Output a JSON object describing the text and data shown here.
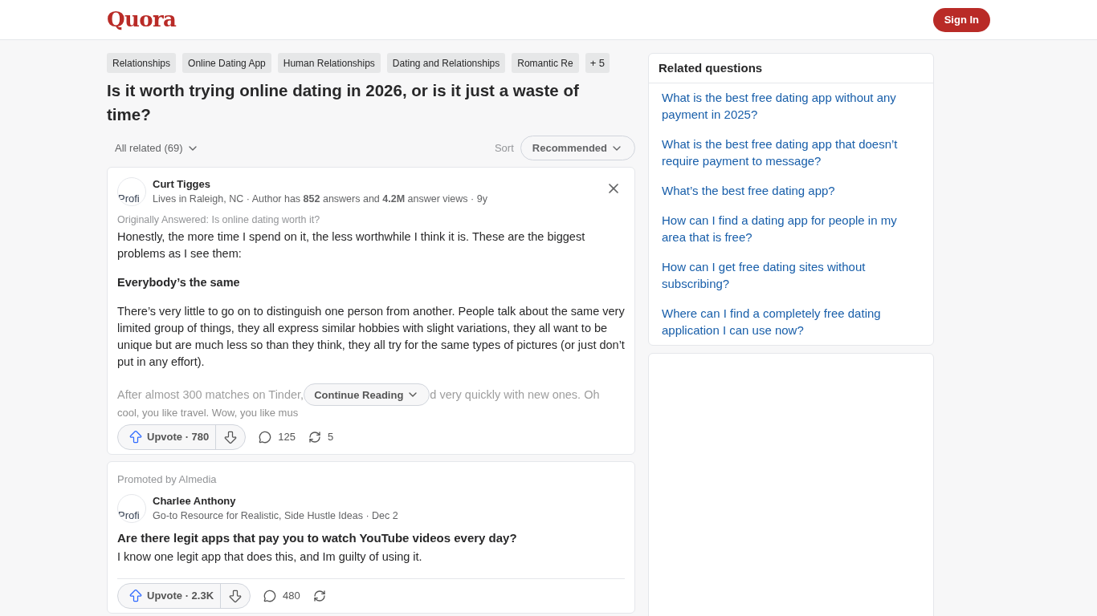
{
  "header": {
    "logo": "Quora",
    "sign_in": "Sign In"
  },
  "topics": [
    "Relationships",
    "Online Dating App",
    "Human Relationships",
    "Dating and Relationships",
    "Romantic Re"
  ],
  "topics_more": "+ 5",
  "question": "Is it worth trying online dating in 2026, or is it just a waste of time?",
  "filter": {
    "all_related": "All related (69)",
    "sort_label": "Sort",
    "sort_value": "Recommended"
  },
  "answers": [
    {
      "kind": "answer",
      "author": "Curt Tigges",
      "avatar_alt": "Profi",
      "meta": "Lives in Raleigh, NC · Author has **852** answers and **4.2M** answer views · 9y",
      "original": "Originally Answered: Is online dating worth it?",
      "paragraphs": [
        {
          "kind": "text",
          "text": "Honestly, the more time I spend on it, the less worthwhile I think it is. These are the biggest problems as I see them:"
        },
        {
          "kind": "heading",
          "text": "Everybody’s the same"
        },
        {
          "kind": "text",
          "text": "There’s very little to go on to distinguish one person from another. People talk about the same very limited group of things, they all express similar hobbies with slight variations, they all want to be unique but are much less so than they think, they all try for the same types of pictures (or just don’t put in any effort)."
        }
      ],
      "faded": {
        "left": "After almost 300 matches on Tinder,",
        "right": "d very quickly with new ones. Oh",
        "line2": "cool, you like travel. Wow, you like mus"
      },
      "continue": "Continue Reading",
      "upvote": "Upvote · 780",
      "comments": "125",
      "shares": "5"
    },
    {
      "kind": "promoted",
      "promoted_by": "Promoted by Almedia",
      "author": "Charlee Anthony",
      "avatar_alt": "Profi",
      "meta": "Go-to Resource for Realistic, Side Hustle Ideas · Dec 2",
      "title": "Are there legit apps that pay you to watch YouTube videos every day?",
      "paragraphs": [
        {
          "kind": "text",
          "text": "I know one legit app that does this, and Im guilty of using it."
        }
      ],
      "upvote": "Upvote · 2.3K",
      "comments": "480"
    }
  ],
  "related": {
    "title": "Related questions",
    "items": [
      "What is the best free dating app without any payment in 2025?",
      "What is the best free dating app that doesn’t require payment to message?",
      "What’s the best free dating app?",
      "How can I find a dating app for people in my area that is free?",
      "How can I get free dating sites without subscribing?",
      "Where can I find a completely free dating application I can use now?"
    ]
  }
}
